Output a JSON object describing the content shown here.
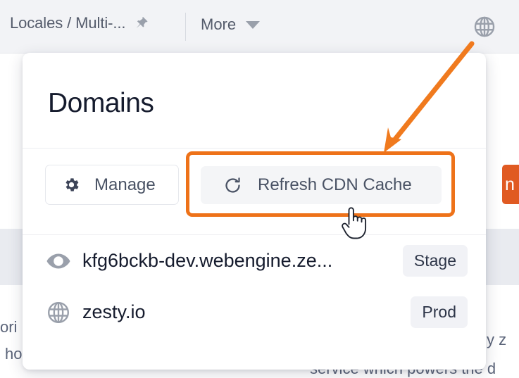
{
  "top_bar": {
    "breadcrumb": "Locales / Multi-...",
    "pin_icon": "pin-icon",
    "more_label": "More",
    "caret_icon": "chevron-down-icon",
    "globe_icon": "globe-icon"
  },
  "background": {
    "publish_button_label": "n",
    "publish_button_color": "#e05a22",
    "text_fragments": {
      "left_1": "ori",
      "left_2": "l ho",
      "right_1": "y z",
      "bottom": "service which powers the d"
    }
  },
  "panel": {
    "title": "Domains",
    "actions": {
      "manage_label": "Manage",
      "manage_icon": "gear-icon",
      "refresh_label": "Refresh CDN Cache",
      "refresh_icon": "refresh-icon",
      "highlight_color": "#ee7219"
    },
    "domains": [
      {
        "icon": "eye-icon",
        "name": "kfg6bckb-dev.webengine.ze...",
        "badge": "Stage"
      },
      {
        "icon": "globe-icon",
        "name": "zesty.io",
        "badge": "Prod"
      }
    ]
  },
  "annotations": {
    "arrow_color": "#f07a1e",
    "cursor": "pointing-hand-cursor"
  }
}
